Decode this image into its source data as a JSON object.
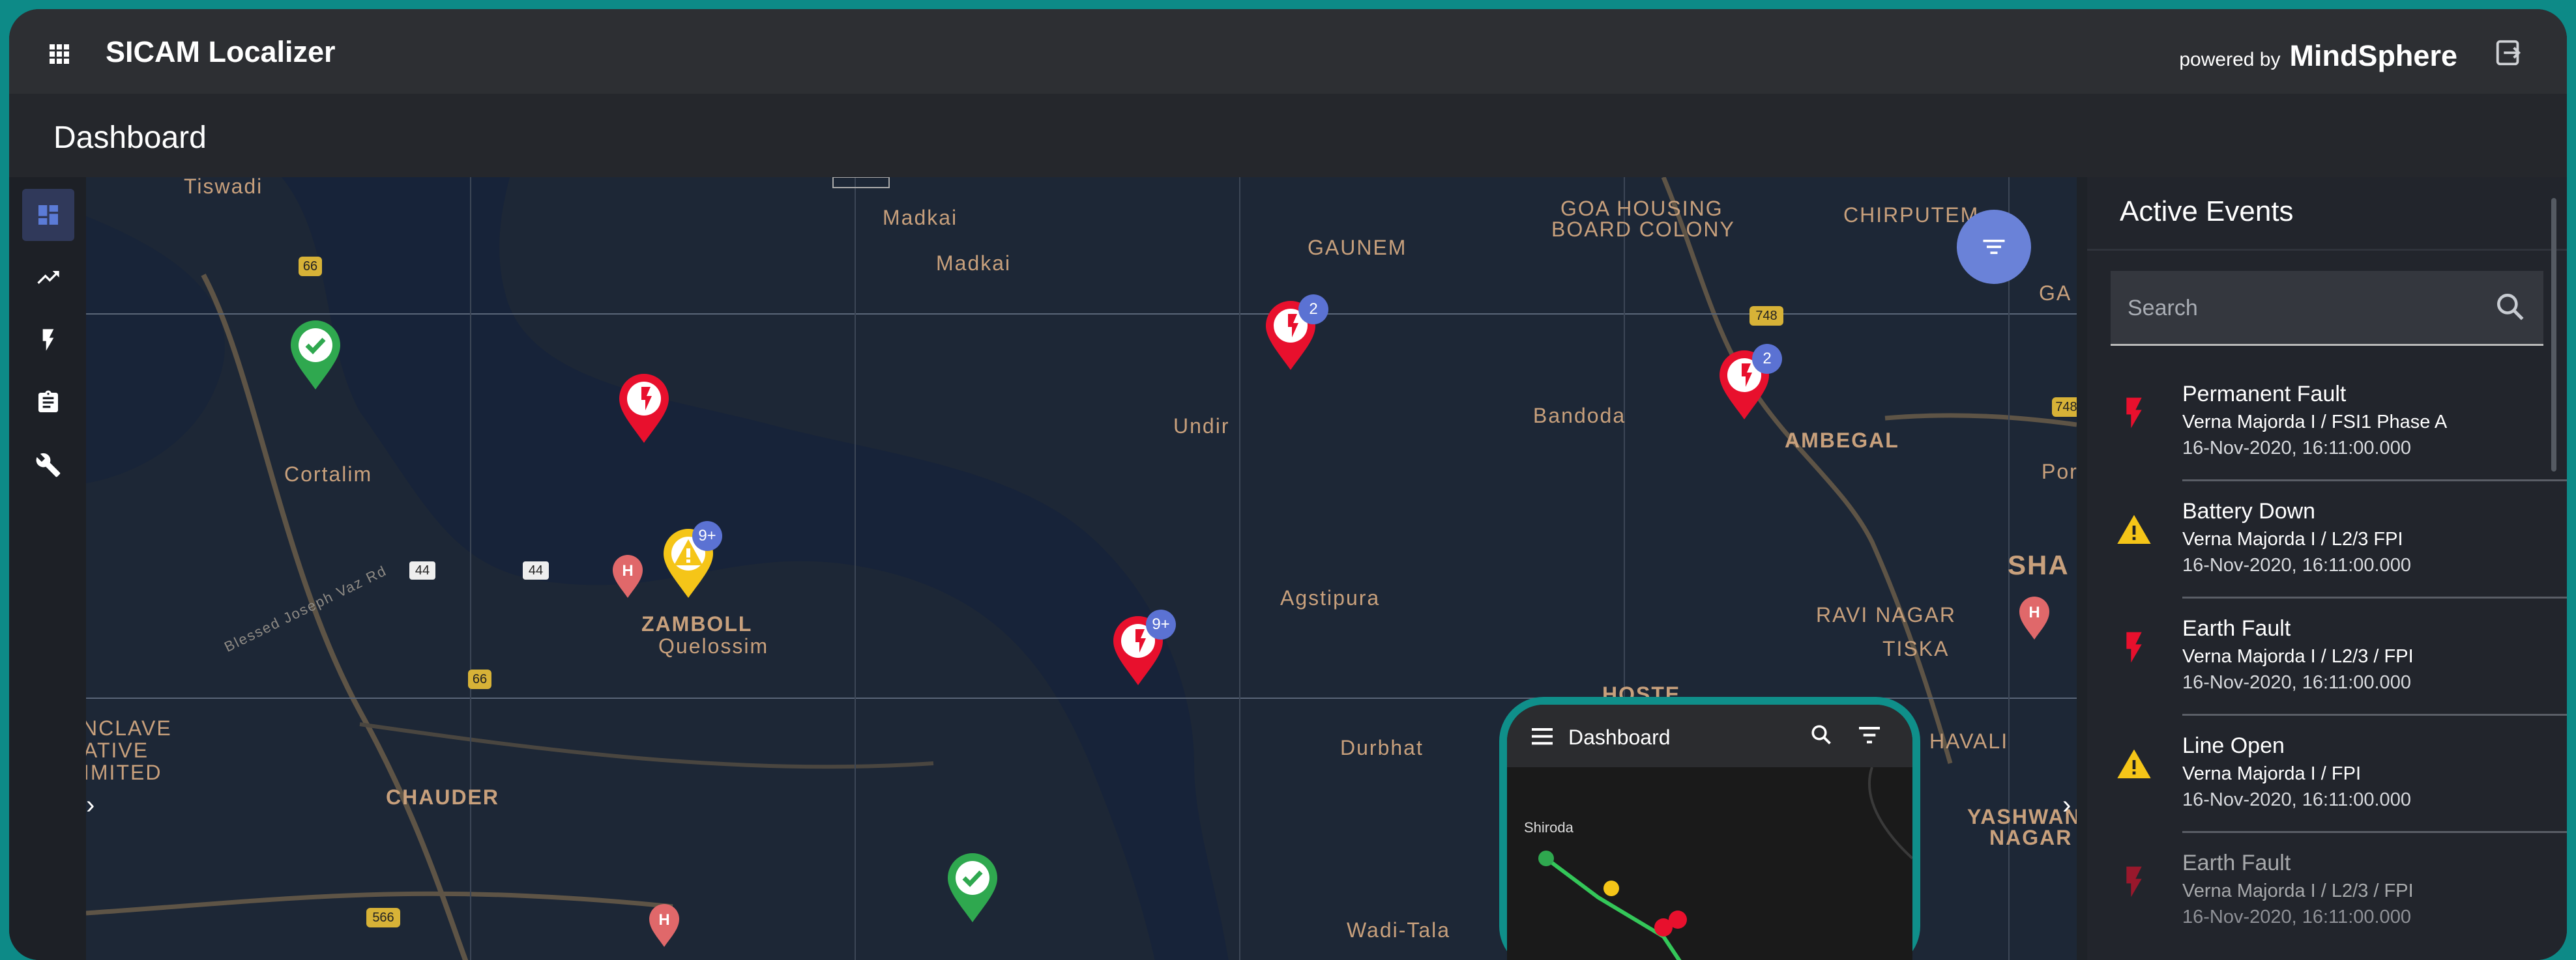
{
  "app": {
    "title": "SICAM Localizer",
    "powered_by_prefix": "powered by",
    "powered_by_brand": "MindSphere",
    "page_title": "Dashboard"
  },
  "nav": [
    "dashboard-icon",
    "trending-up-icon",
    "flash-icon",
    "clipboard-icon",
    "wrench-icon"
  ],
  "map": {
    "labels": {
      "tiswadi": "Tiswadi",
      "madkai1": "Madkai",
      "madkai2": "Madkai",
      "gaunem": "GAUNEM",
      "goa_housing": "GOA HOUSING",
      "board_colony": "BOARD COLONY",
      "chirputem": "CHIRPUTEM",
      "ga": "GA",
      "undir": "Undir",
      "bandoda": "Bandoda",
      "ambegal": "AMBEGAL",
      "por": "Por",
      "cortalim": "Cortalim",
      "zamboll": "ZAMBOLL",
      "quelossim": "Quelossim",
      "agstipura": "Agstipura",
      "sha": "SHA",
      "ravi_nagar": "RAVI NAGAR",
      "tiska": "TISKA",
      "blessed_road": "Blessed Joseph Vaz Rd",
      "nclave": "NCLAVE",
      "ative": "ATIVE",
      "imited": "IMITED",
      "chauder": "CHAUDER",
      "durbhat": "Durbhat",
      "hoste": "HOSTE",
      "havali": "HAVALI",
      "yashwan": "YASHWAN",
      "nagar": "NAGAR",
      "wadi_tala": "Wadi-Tala",
      "shield_66a": "66",
      "shield_66b": "66",
      "shield_44a": "44",
      "shield_44b": "44",
      "shield_748a": "748",
      "shield_748b": "748",
      "shield_566": "566"
    },
    "badges": {
      "fault_top": "2",
      "fault_right": "2",
      "warning": "9+",
      "fault_river": "9+"
    }
  },
  "events_panel": {
    "title": "Active Events",
    "search_placeholder": "Search",
    "events": [
      {
        "icon": "flash-icon",
        "color": "#e8102d",
        "title": "Permanent Fault",
        "path": "Verna Majorda I / FSI1 Phase A",
        "time": "16-Nov-2020, 16:11:00.000"
      },
      {
        "icon": "warning-icon",
        "color": "#f5c518",
        "title": "Battery Down",
        "path": "Verna Majorda I / L2/3 FPI",
        "time": "16-Nov-2020, 16:11:00.000"
      },
      {
        "icon": "flash-icon",
        "color": "#e8102d",
        "title": "Earth Fault",
        "path": "Verna Majorda I  / L2/3 / FPI",
        "time": "16-Nov-2020, 16:11:00.000"
      },
      {
        "icon": "warning-icon",
        "color": "#f5c518",
        "title": "Line Open",
        "path": "Verna Majorda I / FPI",
        "time": "16-Nov-2020, 16:11:00.000"
      },
      {
        "icon": "flash-icon",
        "color": "#e8102d",
        "title": "Earth Fault",
        "path": "Verna Majorda I  / L2/3 / FPI",
        "time": "16-Nov-2020, 16:11:00.000"
      }
    ]
  },
  "phone": {
    "title": "Dashboard",
    "map_label": "Shiroda"
  },
  "colors": {
    "accent": "#0d8a87",
    "fault": "#e8102d",
    "warning": "#f5c518",
    "ok": "#2fa84f",
    "fab": "#6a82d8"
  }
}
